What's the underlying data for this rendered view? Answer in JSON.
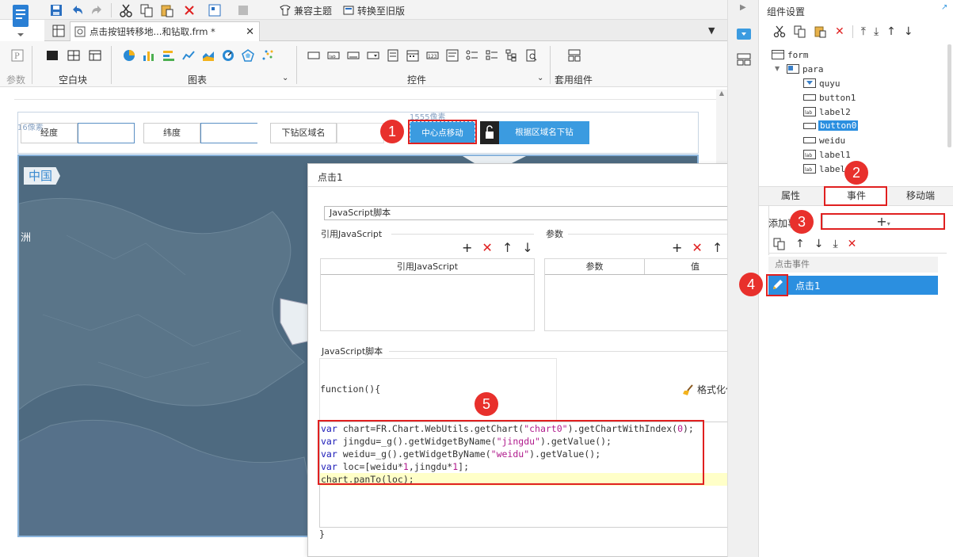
{
  "toolbar": {
    "compat_theme": "兼容主题",
    "convert_old": "转换至旧版"
  },
  "tab": {
    "title": "点击按钮转移地...和钻取.frm *"
  },
  "ribbon": {
    "param_label": "参数",
    "blank_block": "空白块",
    "chart": "图表",
    "widget": "控件",
    "template_widget": "套用组件"
  },
  "canvas": {
    "ruler_16": "16像素",
    "ruler_1555": "1555像素",
    "label_jingdu": "经度",
    "label_weidu": "纬度",
    "label_quyu": "下钻区域名",
    "btn_center": "中心点移动",
    "btn_drill": "根据区域名下钻",
    "map_breadcrumb": "中国",
    "map_label_zhou": "洲"
  },
  "dialog": {
    "title": "点击1",
    "script_type": "JavaScript脚本",
    "ref_js_section": "引用JavaScript",
    "params_section": "参数",
    "ref_js_col": "引用JavaScript",
    "param_col": "参数",
    "value_col": "值",
    "js_script_section": "JavaScript脚本",
    "func_open": "function(){",
    "func_close": "}",
    "format_code": "格式化代码"
  },
  "code_lines": [
    "var chart=FR.Chart.WebUtils.getChart(\"chart0\").getChartWithIndex(0);",
    "var jingdu=_g().getWidgetByName(\"jingdu\").getValue();",
    "var weidu=_g().getWidgetByName(\"weidu\").getValue();",
    "var loc=[weidu*1,jingdu*1];",
    "chart.panTo(loc);"
  ],
  "right_panel": {
    "title": "组件设置",
    "tree": [
      "form",
      "para",
      "quyu",
      "button1",
      "label2",
      "button0",
      "weidu",
      "label1",
      "label"
    ],
    "tabs": [
      "属性",
      "事件",
      "移动端"
    ],
    "add_event": "添加事",
    "event_group": "点击事件",
    "event_item": "点击1"
  },
  "badges": [
    "1",
    "2",
    "3",
    "4",
    "5"
  ],
  "colors": {
    "accent_blue": "#3b9be0",
    "selection_blue": "#2b8fe0",
    "badge_red": "#e8302c",
    "map_bg": "#4e6a80"
  }
}
